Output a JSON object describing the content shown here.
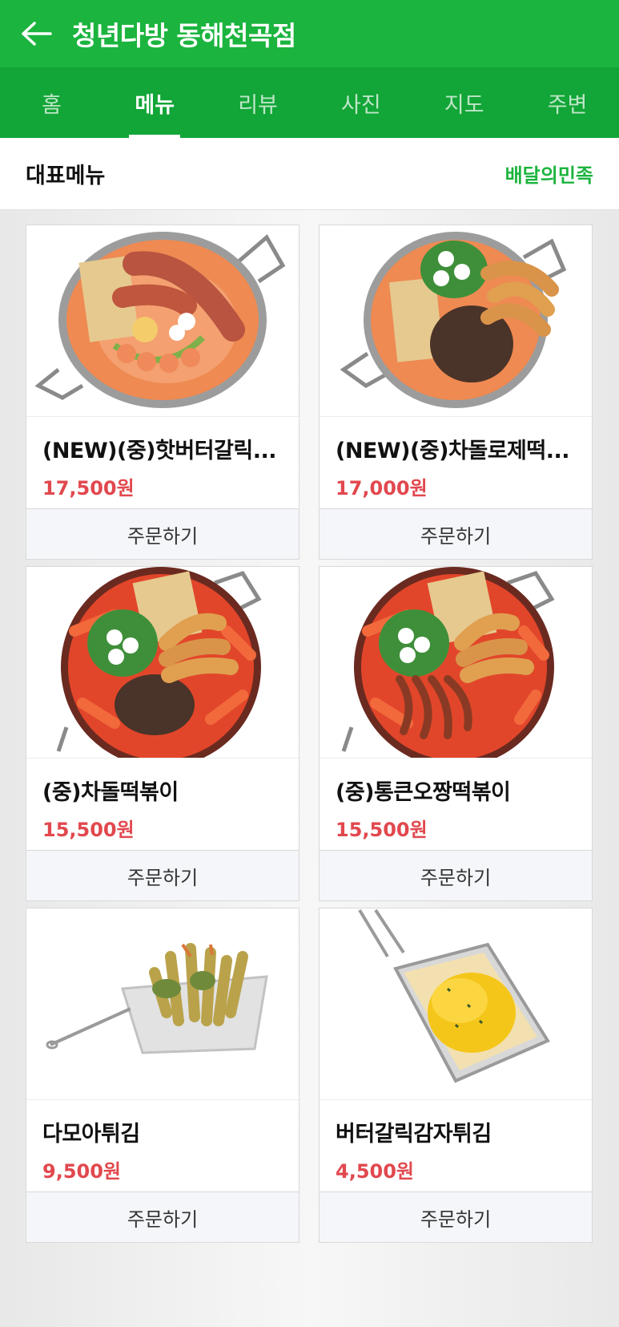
{
  "header": {
    "title": "청년다방 동해천곡점",
    "back_icon": "arrow-left-icon"
  },
  "tabs": [
    {
      "label": "홈",
      "active": false
    },
    {
      "label": "메뉴",
      "active": true
    },
    {
      "label": "리뷰",
      "active": false
    },
    {
      "label": "사진",
      "active": false
    },
    {
      "label": "지도",
      "active": false
    },
    {
      "label": "주변",
      "active": false
    }
  ],
  "section": {
    "title": "대표메뉴",
    "link": "배달의민족"
  },
  "menu": [
    {
      "name": "(NEW)(중)핫버터갈릭...",
      "price": "17,500원",
      "order": "주문하기",
      "image": "tteokbokki-rose-bacon"
    },
    {
      "name": "(NEW)(중)차돌로제떡...",
      "price": "17,000원",
      "order": "주문하기",
      "image": "tteokbokki-rose-beef"
    },
    {
      "name": "(중)차돌떡볶이",
      "price": "15,500원",
      "order": "주문하기",
      "image": "tteokbokki-red-beef"
    },
    {
      "name": "(중)통큰오짱떡볶이",
      "price": "15,500원",
      "order": "주문하기",
      "image": "tteokbokki-red-squid"
    },
    {
      "name": "다모아튀김",
      "price": "9,500원",
      "order": "주문하기",
      "image": "fried-mix-basket"
    },
    {
      "name": "버터갈릭감자튀김",
      "price": "4,500원",
      "order": "주문하기",
      "image": "butter-garlic-fries-basket"
    }
  ],
  "colors": {
    "brand_green": "#1bb43e",
    "tab_green": "#12a537",
    "price_red": "#e1484e"
  }
}
